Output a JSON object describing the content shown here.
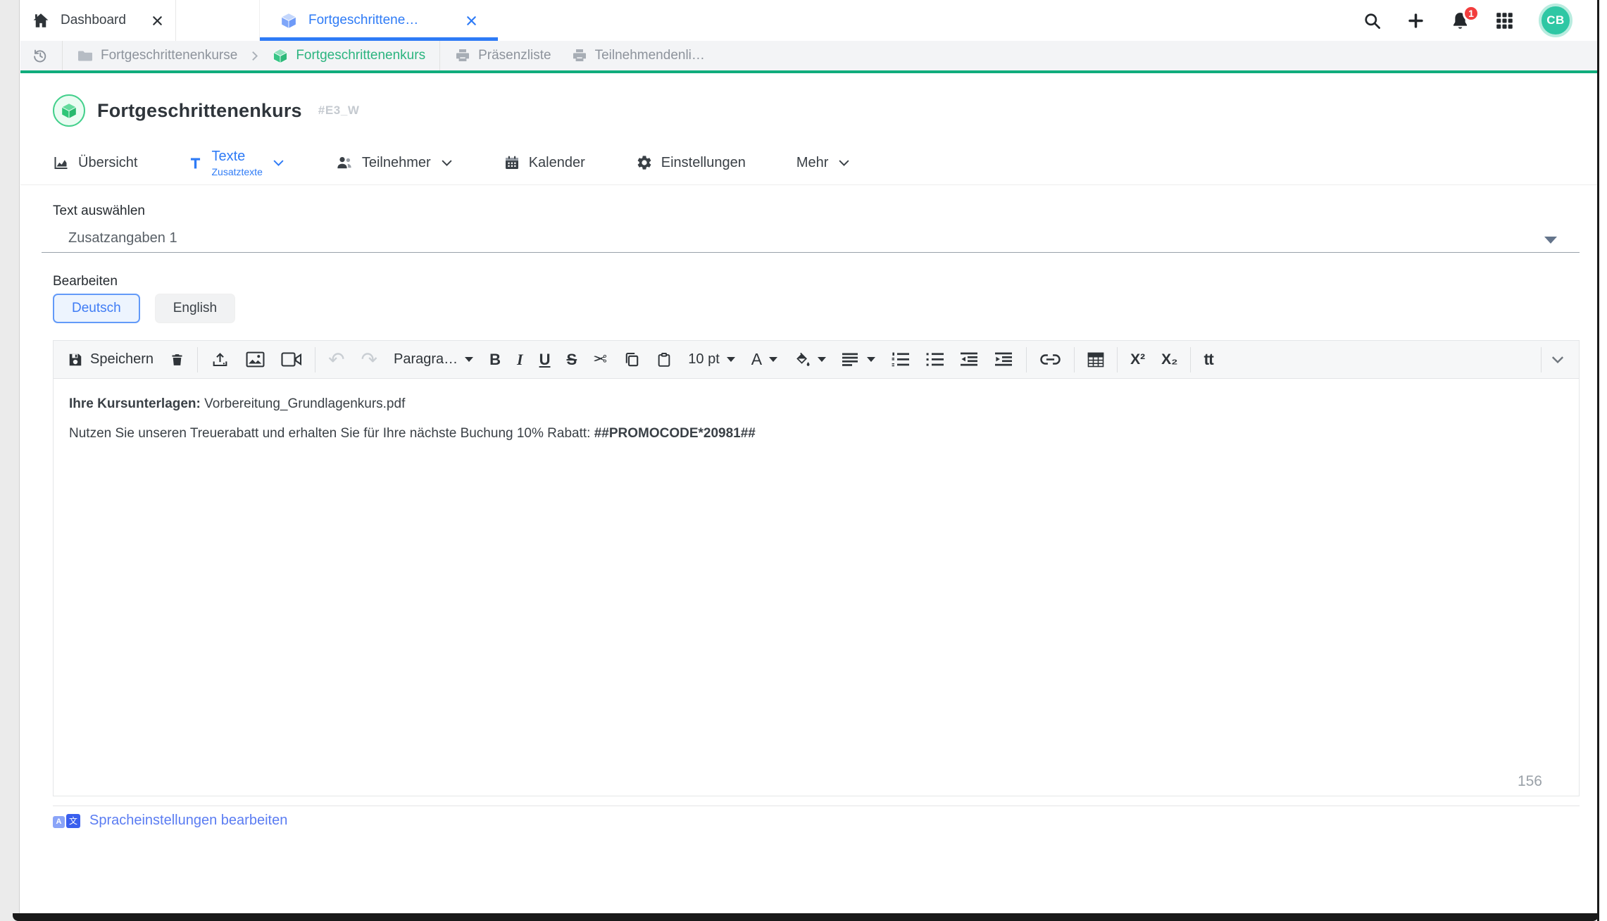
{
  "window_tabs": {
    "dashboard": "Dashboard",
    "course": "Fortgeschrittene…"
  },
  "topbar": {
    "notification_count": "1",
    "avatar_initials": "CB"
  },
  "breadcrumb": {
    "root": "Fortgeschrittenenkurse",
    "current": "Fortgeschrittenenkurs",
    "print_list": "Präsenzliste",
    "participants_list": "Teilnehmendenli…"
  },
  "page": {
    "title": "Fortgeschrittenenkurs",
    "course_code": "#E3_W"
  },
  "nav": {
    "overview": "Übersicht",
    "texts": "Texte",
    "texts_sub": "Zusatztexte",
    "participants": "Teilnehmer",
    "calendar": "Kalender",
    "settings": "Einstellungen",
    "more": "Mehr"
  },
  "form": {
    "select_label": "Text auswählen",
    "select_value": "Zusatzangaben 1",
    "edit_label": "Bearbeiten",
    "lang_de": "Deutsch",
    "lang_en": "English"
  },
  "toolbar": {
    "save": "Speichern",
    "paragraph": "Paragra…",
    "font_size": "10 pt",
    "bold": "B",
    "italic": "I",
    "underline": "U",
    "strikethrough": "S",
    "font_color": "A",
    "superscript": "X²",
    "subscript": "X₂",
    "text_transform": "tt"
  },
  "icons": {
    "scissors": "✂",
    "undo": "↶",
    "redo": "↷",
    "translate_a": "A",
    "translate_char": "文"
  },
  "editor": {
    "line1_bold": "Ihre Kursunterlagen:",
    "line1_text": " Vorbereitung_Grundlagenkurs.pdf",
    "line2_text": "Nutzen Sie unseren Treuerabatt und erhalten Sie für Ihre nächste Buchung 10% Rabatt: ",
    "line2_bold": "##PROMOCODE*20981##",
    "char_count": "156"
  },
  "footer": {
    "language_settings": "Spracheinstellungen bearbeiten"
  },
  "colors": {
    "accent_blue": "#2e7bf6",
    "accent_green": "#2bb47f",
    "green_line": "#10ac7c",
    "avatar_teal": "#2ec7a4",
    "badge_red": "#f23d3d",
    "link_blue": "#5a7cf2"
  }
}
